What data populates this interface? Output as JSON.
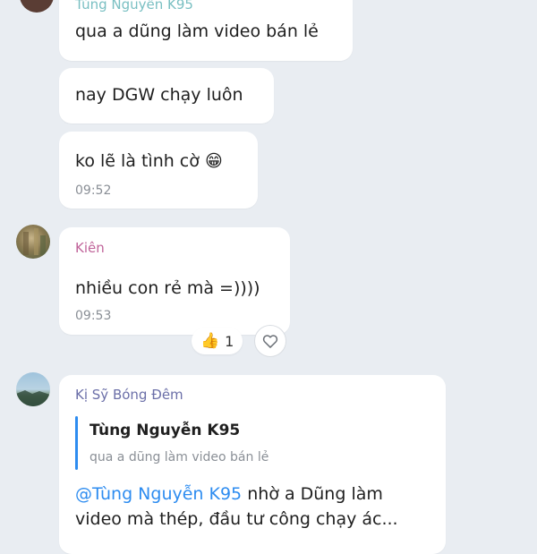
{
  "top_partial_sender": "Tùng Nguyễn K95",
  "messages_group1": [
    {
      "text": "qua a dũng làm video bán lẻ"
    },
    {
      "text": "nay DGW chạy luôn"
    },
    {
      "text": "ko lẽ là tình cờ",
      "emoji": "😁",
      "time": "09:52"
    }
  ],
  "message2": {
    "sender": "Kiên",
    "text": "nhiều con rẻ mà =))))",
    "time": "09:53",
    "reaction_icon": "thumbs-up-icon",
    "reaction_emoji": "👍",
    "reaction_count": "1",
    "like_icon": "heart-outline-icon"
  },
  "message3": {
    "sender": "Kị Sỹ Bóng Đêm",
    "quote_name": "Tùng Nguyễn K95",
    "quote_text": "qua a dũng làm video bán lẻ",
    "mention": "@Tùng Nguyễn K95",
    "line1_rest": " nhờ a Dũng làm",
    "line2": "video mà thép, đầu tư công chạy ác..."
  },
  "colors": {
    "background": "#e9edf2",
    "bubble": "#ffffff",
    "sender_kien": "#c0649a",
    "sender_kisy": "#6b6fa8",
    "accent": "#2d8cf0",
    "time": "#8a8f96"
  }
}
